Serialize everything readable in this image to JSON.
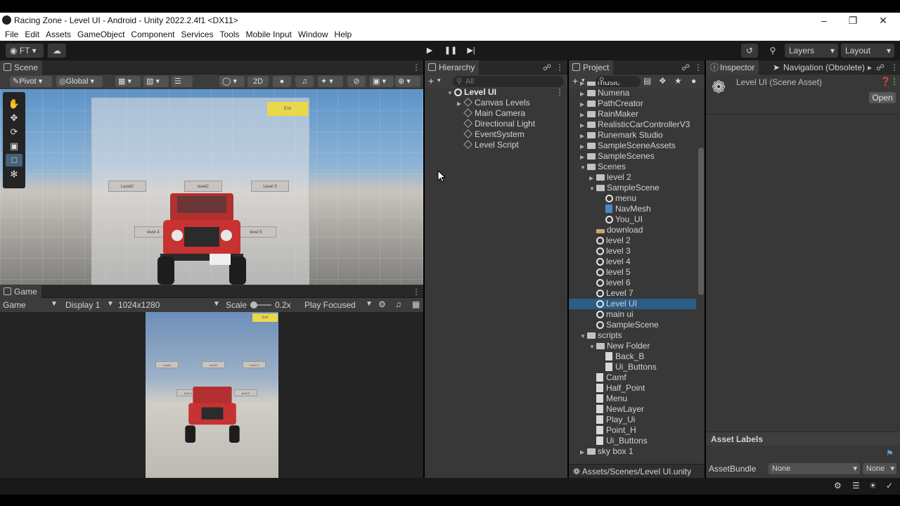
{
  "window": {
    "title": "Racing Zone - Level UI - Android - Unity 2022.2.4f1 <DX11>"
  },
  "menu": [
    "File",
    "Edit",
    "Assets",
    "GameObject",
    "Component",
    "Services",
    "Tools",
    "Mobile Input",
    "Window",
    "Help"
  ],
  "toolbar": {
    "account": "FT",
    "layers": "Layers",
    "layout": "Layout"
  },
  "scene": {
    "tab": "Scene",
    "pivot": "Pivot",
    "global": "Global",
    "mode2d": "2D",
    "exit_label": "Exit",
    "level_buttons": [
      "Level2",
      "level2",
      "Level 3",
      "level 4",
      "level 5"
    ]
  },
  "game": {
    "tab": "Game",
    "mode": "Game",
    "display": "Display 1",
    "resolution": "1024x1280",
    "scale_label": "Scale",
    "scale_value": "0.2x",
    "play_mode": "Play Focused"
  },
  "hierarchy": {
    "tab": "Hierarchy",
    "search_placeholder": "All",
    "root": "Level UI",
    "children": [
      "Canvas Levels",
      "Main Camera",
      "Directional Light",
      "EventSystem",
      "Level Script"
    ]
  },
  "project": {
    "tab": "Project",
    "rows": [
      {
        "label": "music",
        "depth": 0,
        "icon": "folder",
        "arrow": "right"
      },
      {
        "label": "Numena",
        "depth": 0,
        "icon": "folder",
        "arrow": "right"
      },
      {
        "label": "PathCreator",
        "depth": 0,
        "icon": "folder",
        "arrow": "right"
      },
      {
        "label": "RainMaker",
        "depth": 0,
        "icon": "folder",
        "arrow": "right"
      },
      {
        "label": "RealisticCarControllerV3",
        "depth": 0,
        "icon": "folder",
        "arrow": "right"
      },
      {
        "label": "Runemark Studio",
        "depth": 0,
        "icon": "folder",
        "arrow": "right"
      },
      {
        "label": "SampleSceneAssets",
        "depth": 0,
        "icon": "folder",
        "arrow": "right"
      },
      {
        "label": "SampleScenes",
        "depth": 0,
        "icon": "folder",
        "arrow": "right"
      },
      {
        "label": "Scenes",
        "depth": 0,
        "icon": "folder",
        "arrow": "down"
      },
      {
        "label": "level 2",
        "depth": 1,
        "icon": "folder",
        "arrow": "right"
      },
      {
        "label": "SampleScene",
        "depth": 1,
        "icon": "folder",
        "arrow": "down"
      },
      {
        "label": "menu",
        "depth": 2,
        "icon": "unity",
        "arrow": ""
      },
      {
        "label": "NavMesh",
        "depth": 2,
        "icon": "navmesh",
        "arrow": ""
      },
      {
        "label": "You_UI",
        "depth": 2,
        "icon": "unity",
        "arrow": ""
      },
      {
        "label": "download",
        "depth": 1,
        "icon": "image",
        "arrow": ""
      },
      {
        "label": "level 2",
        "depth": 1,
        "icon": "unity",
        "arrow": ""
      },
      {
        "label": "level 3",
        "depth": 1,
        "icon": "unity",
        "arrow": ""
      },
      {
        "label": "level 4",
        "depth": 1,
        "icon": "unity",
        "arrow": ""
      },
      {
        "label": "level 5",
        "depth": 1,
        "icon": "unity",
        "arrow": ""
      },
      {
        "label": "level 6",
        "depth": 1,
        "icon": "unity",
        "arrow": ""
      },
      {
        "label": "Level 7",
        "depth": 1,
        "icon": "unity",
        "arrow": ""
      },
      {
        "label": "Level UI",
        "depth": 1,
        "icon": "unity",
        "arrow": "",
        "selected": true
      },
      {
        "label": "main ui",
        "depth": 1,
        "icon": "unity",
        "arrow": ""
      },
      {
        "label": "SampleScene",
        "depth": 1,
        "icon": "unity",
        "arrow": ""
      },
      {
        "label": "scripts",
        "depth": 0,
        "icon": "folder",
        "arrow": "down"
      },
      {
        "label": "New Folder",
        "depth": 1,
        "icon": "folder",
        "arrow": "down"
      },
      {
        "label": "Back_B",
        "depth": 2,
        "icon": "script",
        "arrow": ""
      },
      {
        "label": "Ui_Buttons",
        "depth": 2,
        "icon": "script",
        "arrow": ""
      },
      {
        "label": "Camf",
        "depth": 1,
        "icon": "script",
        "arrow": ""
      },
      {
        "label": "Half_Point",
        "depth": 1,
        "icon": "script",
        "arrow": ""
      },
      {
        "label": "Menu",
        "depth": 1,
        "icon": "script",
        "arrow": ""
      },
      {
        "label": "NewLayer",
        "depth": 1,
        "icon": "doc",
        "arrow": ""
      },
      {
        "label": "Play_Ui",
        "depth": 1,
        "icon": "script",
        "arrow": ""
      },
      {
        "label": "Point_H",
        "depth": 1,
        "icon": "script",
        "arrow": ""
      },
      {
        "label": "Ui_Buttons",
        "depth": 1,
        "icon": "script",
        "arrow": ""
      },
      {
        "label": "sky box 1",
        "depth": 0,
        "icon": "folder",
        "arrow": "right"
      }
    ],
    "path": "Assets/Scenes/Level UI.unity"
  },
  "inspector": {
    "tab": "Inspector",
    "tab2": "Navigation (Obsolete)",
    "asset_title": "Level UI (Scene Asset)",
    "open_button": "Open",
    "asset_labels": "Asset Labels",
    "asset_bundle_label": "AssetBundle",
    "asset_bundle_value": "None",
    "asset_bundle_variant": "None"
  },
  "colors": {
    "selection": "#2c5d87",
    "panel": "#383838",
    "toolbar": "#191919"
  }
}
